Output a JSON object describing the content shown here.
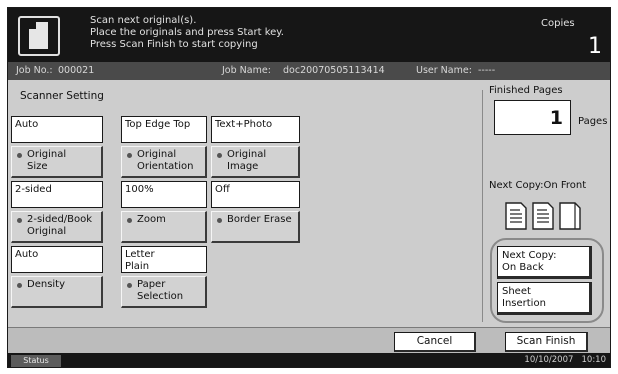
{
  "header": {
    "message_lines": [
      "Scan next original(s).",
      "Place the originals and press Start key.",
      "Press Scan Finish to start copying"
    ],
    "copies_label": "Copies",
    "copies_count": "1"
  },
  "jobbar": {
    "job_no_label": "Job No.:",
    "job_no": "000021",
    "job_name_label": "Job Name:",
    "job_name": "doc20070505113414",
    "user_name_label": "User Name:",
    "user_name": "-----"
  },
  "scanner": {
    "title": "Scanner Setting",
    "settings": [
      {
        "value_lines": [
          "Auto"
        ],
        "button_lines": [
          "Original",
          "Size"
        ]
      },
      {
        "value_lines": [
          "Top Edge Top"
        ],
        "button_lines": [
          "Original",
          "Orientation"
        ]
      },
      {
        "value_lines": [
          "Text+Photo"
        ],
        "button_lines": [
          "Original",
          "Image"
        ]
      },
      {
        "value_lines": [
          "2-sided"
        ],
        "button_lines": [
          "2-sided/Book",
          "Original"
        ]
      },
      {
        "value_lines": [
          "100%"
        ],
        "button_lines": [
          "Zoom"
        ]
      },
      {
        "value_lines": [
          "Off"
        ],
        "button_lines": [
          "Border Erase"
        ]
      },
      {
        "value_lines": [
          "Auto"
        ],
        "button_lines": [
          "Density"
        ]
      },
      {
        "value_lines": [
          "Letter",
          "Plain"
        ],
        "button_lines": [
          "Paper",
          "Selection"
        ]
      }
    ]
  },
  "right_panel": {
    "finished_label": "Finished Pages",
    "pages_count": "1",
    "pages_unit": "Pages",
    "next_copy_label": "Next Copy:On Front",
    "page_icons": [
      "page-lines-icon",
      "page-lines-icon",
      "page-blank-icon"
    ],
    "next_copy_back_lines": [
      "Next Copy:",
      "On Back"
    ],
    "sheet_insertion_lines": [
      "Sheet",
      "Insertion"
    ]
  },
  "bottom": {
    "cancel_label": "Cancel",
    "scan_finish_label": "Scan Finish"
  },
  "statusbar": {
    "status_label": "Status",
    "datetime": "10/10/2007   10:10"
  }
}
